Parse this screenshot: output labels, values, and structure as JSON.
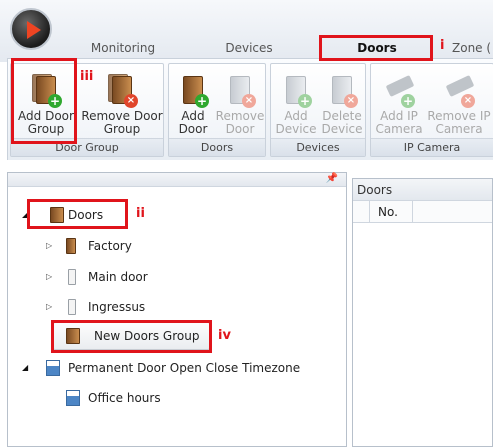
{
  "tabs": [
    {
      "label": "Monitoring"
    },
    {
      "label": "Devices"
    },
    {
      "label": "Doors",
      "active": true
    },
    {
      "label": "Zone ("
    }
  ],
  "ribbon": {
    "groups": [
      {
        "label": "Door Group",
        "buttons": [
          {
            "label": "Add Door\nGroup",
            "icon": "add-door-group-icon",
            "enabled": true
          },
          {
            "label": "Remove Door\nGroup",
            "icon": "remove-door-group-icon",
            "enabled": true
          }
        ]
      },
      {
        "label": "Doors",
        "buttons": [
          {
            "label": "Add\nDoor",
            "icon": "add-door-icon",
            "enabled": true
          },
          {
            "label": "Remove\nDoor",
            "icon": "remove-door-icon",
            "enabled": false
          }
        ]
      },
      {
        "label": "Devices",
        "buttons": [
          {
            "label": "Add\nDevice",
            "icon": "add-device-icon",
            "enabled": false
          },
          {
            "label": "Delete\nDevice",
            "icon": "delete-device-icon",
            "enabled": false
          }
        ]
      },
      {
        "label": "IP Camera",
        "buttons": [
          {
            "label": "Add IP\nCamera",
            "icon": "add-ip-camera-icon",
            "enabled": false
          },
          {
            "label": "Remove IP\nCamera",
            "icon": "remove-ip-camera-icon",
            "enabled": false
          }
        ]
      }
    ]
  },
  "tree": {
    "pin_icon": "pin-icon",
    "items": [
      {
        "label": "Doors",
        "icon": "door-group-icon",
        "expanded": true
      },
      {
        "label": "Factory",
        "icon": "door-icon"
      },
      {
        "label": "Main door",
        "icon": "door-icon"
      },
      {
        "label": "Ingressus",
        "icon": "door-icon"
      },
      {
        "label": "New Doors Group",
        "icon": "door-group-icon"
      },
      {
        "label": "Permanent Door Open Close Timezone",
        "icon": "calendar-icon",
        "expanded": true
      },
      {
        "label": "Office hours",
        "icon": "calendar-icon"
      }
    ]
  },
  "right_pane": {
    "title": "Doors",
    "columns": [
      "No."
    ]
  },
  "annotations": [
    "i",
    "ii",
    "iii",
    "iv"
  ],
  "colors": {
    "annotation": "#e0141b",
    "accent": "#ee4422"
  }
}
